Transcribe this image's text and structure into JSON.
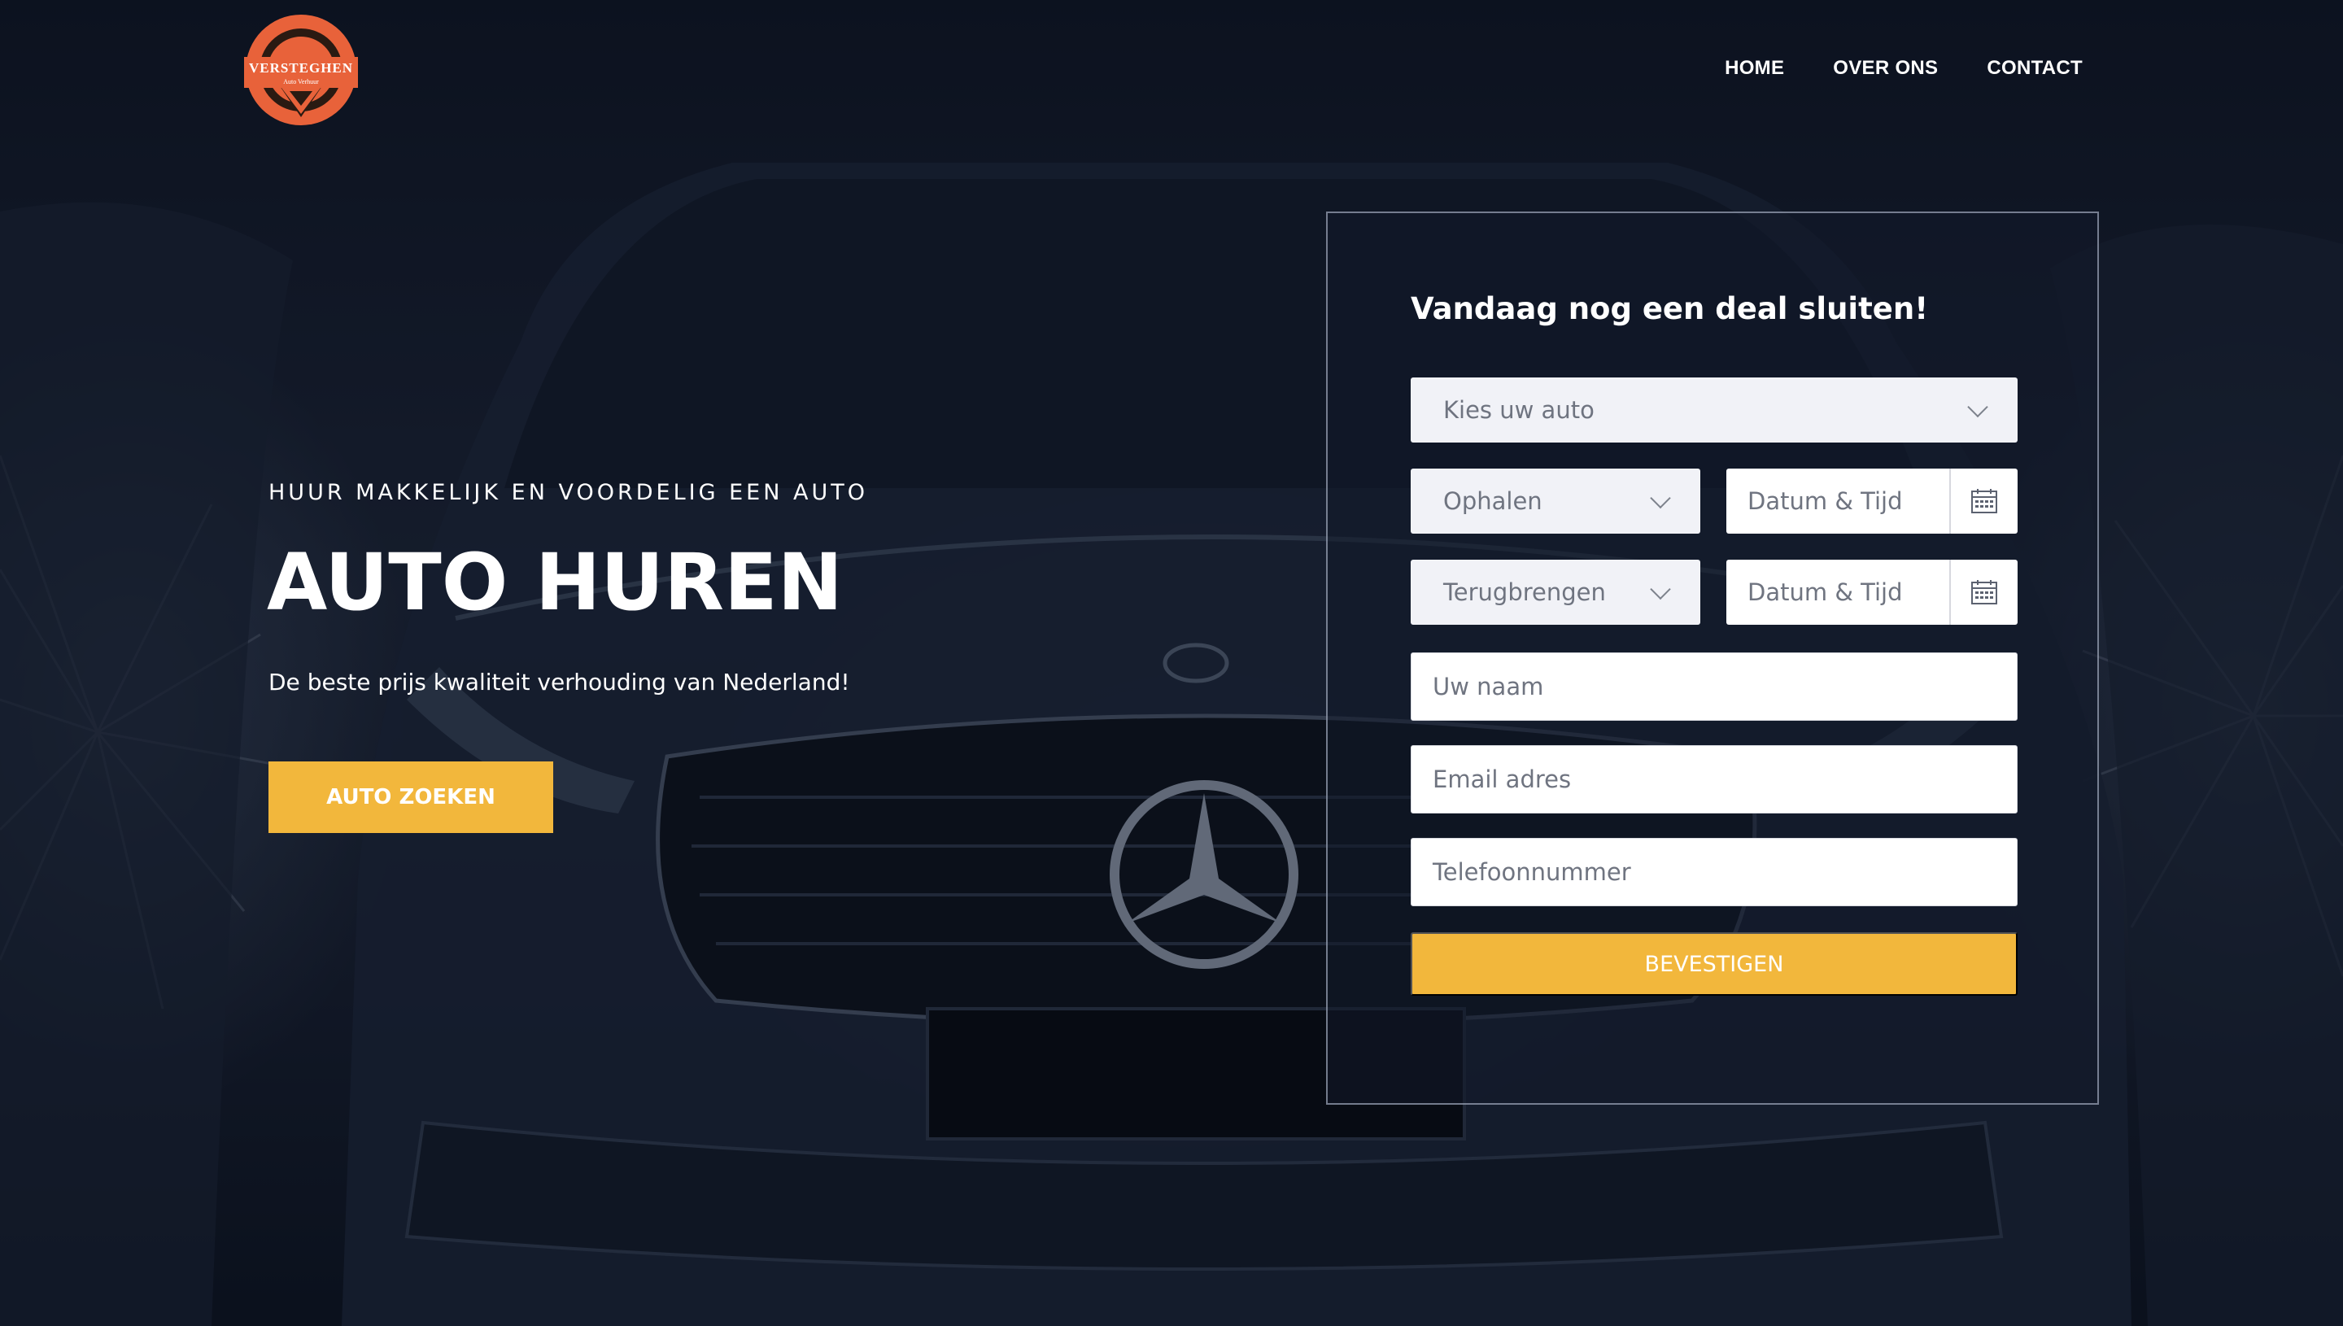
{
  "logo": {
    "name": "VERSTEGHEN",
    "tagline": "Auto Verhuur"
  },
  "nav": {
    "items": [
      "HOME",
      "OVER ONS",
      "CONTACT"
    ]
  },
  "hero": {
    "eyebrow": "HUUR MAKKELIJK EN VOORDELIG EEN AUTO",
    "title": "AUTO HUREN",
    "subtitle": "De beste prijs kwaliteit verhouding van Nederland!",
    "button_label": "AUTO ZOEKEN"
  },
  "form": {
    "title": "Vandaag nog een deal sluiten!",
    "car_select": "Kies uw auto",
    "pickup_select": "Ophalen",
    "pickup_date_placeholder": "Datum & Tijd",
    "return_select": "Terugbrengen",
    "return_date_placeholder": "Datum & Tijd",
    "name_placeholder": "Uw naam",
    "email_placeholder": "Email adres",
    "phone_placeholder": "Telefoonnummer",
    "submit_label": "BEVESTIGEN"
  },
  "colors": {
    "accent": "#f2b73c",
    "logo": "#e8623a",
    "background": "#141b29"
  }
}
